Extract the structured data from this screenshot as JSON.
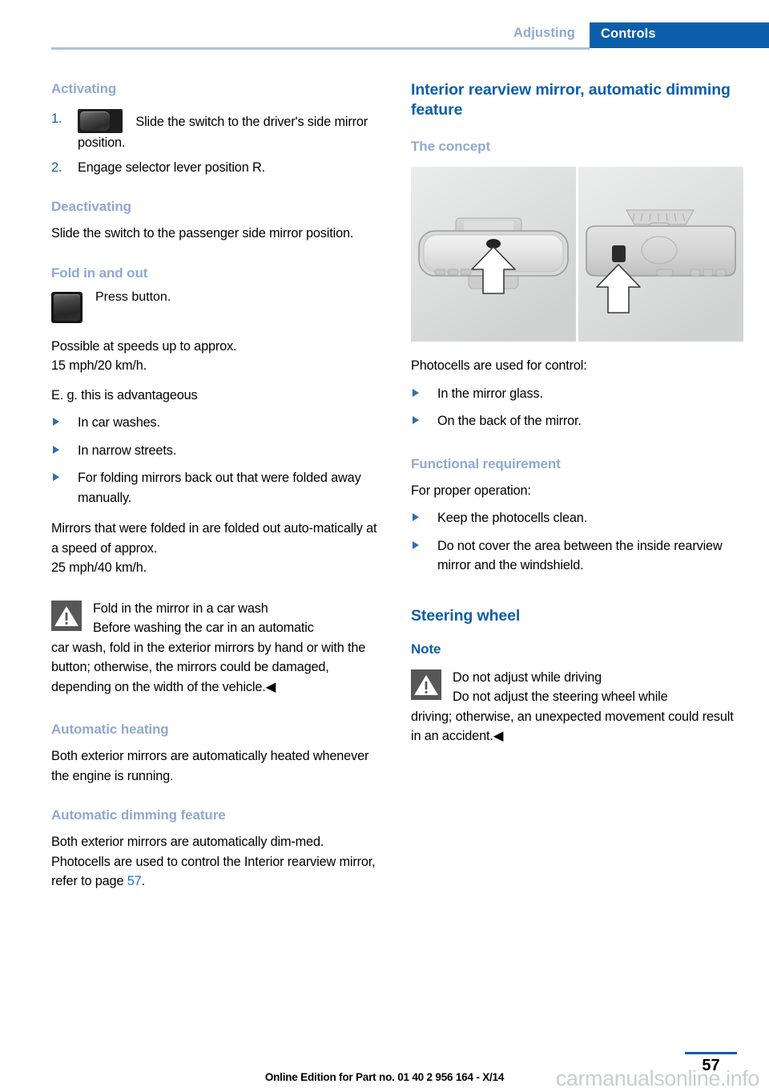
{
  "header": {
    "breadcrumb": "Adjusting",
    "section": "Controls"
  },
  "left_column": {
    "activating": {
      "heading": "Activating",
      "steps": [
        {
          "num": "1.",
          "icon": "rocker-switch-icon",
          "text": "Slide the switch to the driver's side mirror position."
        },
        {
          "num": "2.",
          "icon": "",
          "text": "Engage selector lever position R."
        }
      ]
    },
    "deactivating": {
      "heading": "Deactivating",
      "body": "Slide the switch to the passenger side mirror position."
    },
    "fold": {
      "heading": "Fold in and out",
      "icon": "press-button-icon",
      "icon_label": "Press button.",
      "speed_note": "Possible at speeds up to approx.\n15 mph/20 km/h.",
      "eg_intro": "E. g. this is advantageous",
      "bullets": [
        "In car washes.",
        "In narrow streets.",
        "For folding mirrors back out that were folded away manually."
      ],
      "auto_fold": "Mirrors that were folded in are folded out auto-matically at a speed of approx.\n25 mph/40 km/h."
    },
    "warning": {
      "icon": "warning-triangle-icon",
      "title": "Fold in the mirror in a car wash",
      "body_first": "Before washing the car in an automatic",
      "body_rest": "car wash, fold in the exterior mirrors by hand or with the button; otherwise, the mirrors could be damaged, depending on the width of the vehicle.",
      "end_mark": "◀"
    },
    "auto_heating": {
      "heading": "Automatic heating",
      "body": "Both exterior mirrors are automatically heated whenever the engine is running."
    },
    "auto_dimming": {
      "heading": "Automatic dimming feature",
      "body_before": "Both exterior mirrors are automatically dim-med. Photocells are used to control the Interior rearview mirror, refer to page ",
      "page_ref": "57",
      "body_after": "."
    }
  },
  "right_column": {
    "title": "Interior rearview mirror, automatic dimming feature",
    "concept": {
      "heading": "The concept",
      "figure_caption": "",
      "figure_alt_left": "rearview-mirror-front-photocell",
      "figure_alt_right": "rearview-mirror-back-photocell",
      "intro": "Photocells are used for control:",
      "bullets": [
        "In the mirror glass.",
        "On the back of the mirror."
      ]
    },
    "functional": {
      "heading": "Functional requirement",
      "intro": "For proper operation:",
      "bullets": [
        "Keep the photocells clean.",
        "Do not cover the area between the inside rearview mirror and the windshield."
      ]
    },
    "steering": {
      "title": "Steering wheel",
      "note_heading": "Note",
      "icon": "warning-triangle-icon",
      "warn_title": "Do not adjust while driving",
      "warn_first": "Do not adjust the steering wheel while",
      "warn_rest": "driving; otherwise, an unexpected movement could result in an accident.",
      "end_mark": "◀"
    }
  },
  "footer": {
    "page_number": "57",
    "edition": "Online Edition for Part no. 01 40 2 956 164 - X/14",
    "watermark": "carmanualsonline.info"
  },
  "colors": {
    "accent_blue": "#0d5eaa",
    "light_blue": "#8fa9cf",
    "rule_blue": "#a8c2e2",
    "link_blue": "#1a6fd4",
    "warn_gray": "#575757"
  }
}
